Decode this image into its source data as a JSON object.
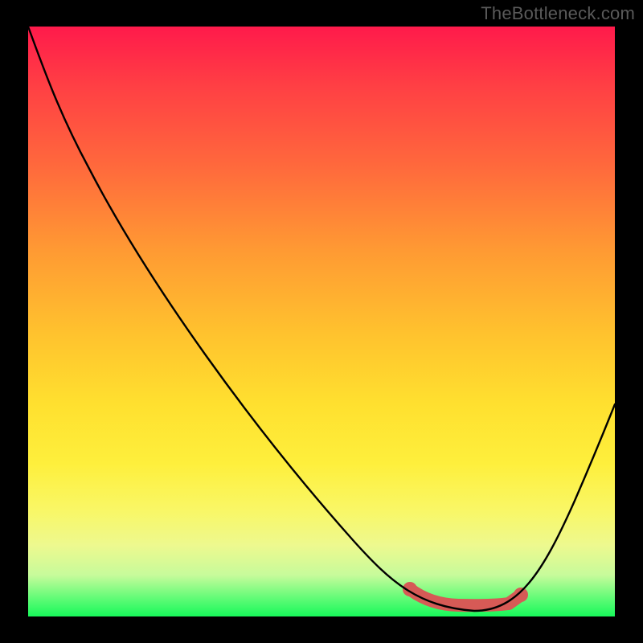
{
  "watermark": "TheBottleneck.com",
  "colors": {
    "frame": "#000000",
    "gradient_top": "#ff1a4b",
    "gradient_bottom": "#17f85a",
    "curve": "#000000",
    "band": "#d65a56",
    "watermark_text": "#5a5a5a"
  },
  "chart_data": {
    "type": "line",
    "title": "",
    "xlabel": "",
    "ylabel": "",
    "xlim": [
      0,
      100
    ],
    "ylim": [
      0,
      100
    ],
    "grid": false,
    "legend": false,
    "background": "vertical gradient red→orange→yellow→green (bottleneck heatmap)",
    "series": [
      {
        "name": "bottleneck_curve",
        "x": [
          0,
          5,
          10,
          20,
          30,
          40,
          50,
          55,
          62,
          70,
          76,
          82,
          88,
          93,
          100
        ],
        "y": [
          100,
          93,
          85,
          70,
          55,
          40,
          25,
          17,
          10,
          4,
          1,
          1,
          8,
          20,
          36
        ]
      }
    ],
    "annotations": [
      {
        "name": "optimal_range_band",
        "x_range": [
          65,
          84
        ],
        "y_approx": 2,
        "color": "#d65a56",
        "description": "thick rounded highlight marking the flat minimum of the curve"
      }
    ]
  }
}
